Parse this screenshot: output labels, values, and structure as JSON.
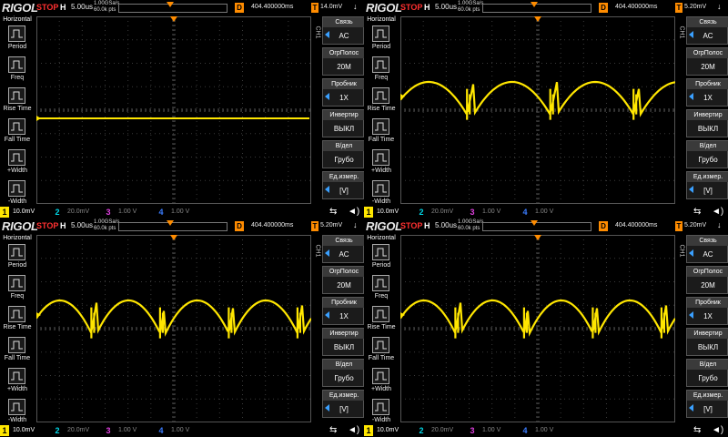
{
  "panels": [
    {
      "id": "p1",
      "brand": "RIGOL",
      "run_state": "STOP",
      "timebase": "5.00us",
      "sample_rate": "1.00GSa/s",
      "mem_depth": "60.0k pts",
      "delay": "404.400000ms",
      "trigger_level": "14.0mV",
      "waveform": "flat",
      "channels": [
        {
          "num": "1",
          "scale": "10.0mV",
          "color": "#ffe600"
        },
        {
          "num": "2",
          "scale": "20.0mV",
          "color": "#00d8e8"
        },
        {
          "num": "3",
          "scale": "1.00 V",
          "color": "#e040e0"
        },
        {
          "num": "4",
          "scale": "1.00 V",
          "color": "#3a7cff"
        }
      ]
    },
    {
      "id": "p2",
      "brand": "RIGOL",
      "run_state": "STOP",
      "timebase": "5.00us",
      "sample_rate": "1.00GSa/s",
      "mem_depth": "60.0k pts",
      "delay": "404.400000ms",
      "trigger_level": "5.20mV",
      "waveform": "ripple3",
      "channels": [
        {
          "num": "1",
          "scale": "10.0mV",
          "color": "#ffe600"
        },
        {
          "num": "2",
          "scale": "20.0mV",
          "color": "#00d8e8"
        },
        {
          "num": "3",
          "scale": "1.00 V",
          "color": "#e040e0"
        },
        {
          "num": "4",
          "scale": "1.00 V",
          "color": "#3a7cff"
        }
      ]
    },
    {
      "id": "p3",
      "brand": "RIGOL",
      "run_state": "STOP",
      "timebase": "5.00us",
      "sample_rate": "1.00GSa/s",
      "mem_depth": "60.0k pts",
      "delay": "404.400000ms",
      "trigger_level": "5.20mV",
      "waveform": "ripple4",
      "channels": [
        {
          "num": "1",
          "scale": "10.0mV",
          "color": "#ffe600"
        },
        {
          "num": "2",
          "scale": "20.0mV",
          "color": "#00d8e8"
        },
        {
          "num": "3",
          "scale": "1.00 V",
          "color": "#e040e0"
        },
        {
          "num": "4",
          "scale": "1.00 V",
          "color": "#3a7cff"
        }
      ]
    },
    {
      "id": "p4",
      "brand": "RIGOL",
      "run_state": "STOP",
      "timebase": "5.00us",
      "sample_rate": "1.00GSa/s",
      "mem_depth": "60.0k pts",
      "delay": "404.400000ms",
      "trigger_level": "5.20mV",
      "waveform": "ripple4",
      "channels": [
        {
          "num": "1",
          "scale": "10.0mV",
          "color": "#ffe600"
        },
        {
          "num": "2",
          "scale": "20.0mV",
          "color": "#00d8e8"
        },
        {
          "num": "3",
          "scale": "1.00 V",
          "color": "#e040e0"
        },
        {
          "num": "4",
          "scale": "1.00 V",
          "color": "#3a7cff"
        }
      ]
    }
  ],
  "left_menu": {
    "title": "Horizontal",
    "items": [
      {
        "label": "Period",
        "icon": "period-icon"
      },
      {
        "label": "Freq",
        "icon": "freq-icon"
      },
      {
        "label": "Rise Time",
        "icon": "rise-time-icon"
      },
      {
        "label": "Fall Time",
        "icon": "fall-time-icon"
      },
      {
        "label": "+Width",
        "icon": "positive-width-icon"
      },
      {
        "label": "-Width",
        "icon": "negative-width-icon"
      }
    ]
  },
  "right_menu": {
    "channel_label": "CH1",
    "items": [
      {
        "title": "Связь",
        "value": "AC",
        "has_arrow": true
      },
      {
        "title": "ОгрПолос",
        "value": "20M",
        "has_arrow": false
      },
      {
        "title": "Пробник",
        "value": "1X",
        "has_arrow": true
      },
      {
        "title": "Инвертир",
        "value": "ВЫКЛ",
        "has_arrow": false
      },
      {
        "title": "В/дел",
        "value": "Грубо",
        "has_arrow": false
      },
      {
        "title": "Ед.измер.",
        "value": "[V]",
        "has_arrow": true
      }
    ]
  },
  "labels": {
    "h_chip": "H",
    "d_chip": "D",
    "t_chip": "T",
    "t_arrow": "↓"
  },
  "colors": {
    "trace": "#ffe600",
    "grid": "#3a3a3a",
    "accent": "#ff8c00",
    "stop": "#ff3030"
  }
}
